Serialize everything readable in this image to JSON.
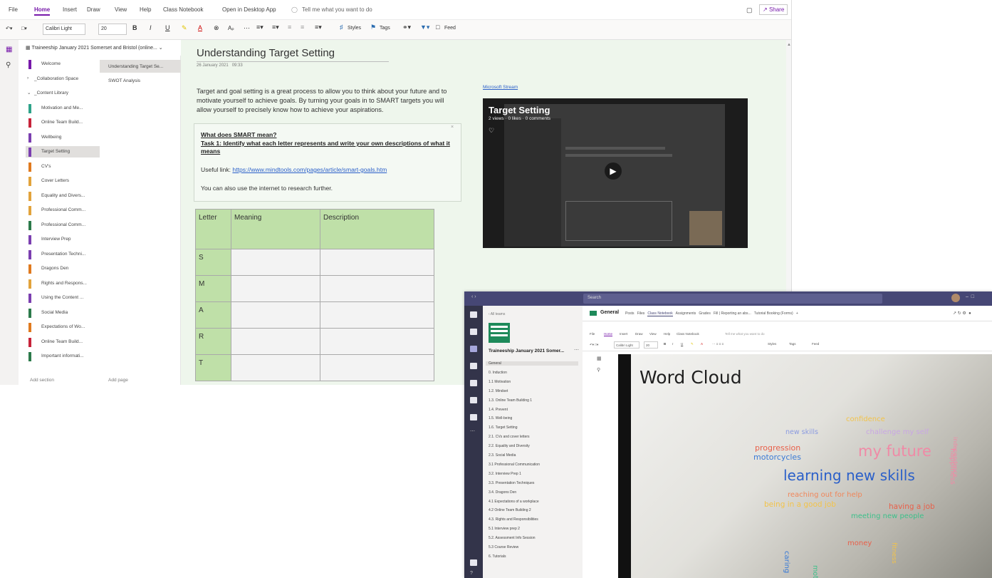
{
  "onenote": {
    "menu": [
      "File",
      "Home",
      "Insert",
      "Draw",
      "View",
      "Help",
      "Class Notebook",
      "Open in Desktop App",
      "Tell me what you want to do"
    ],
    "share_label": "Share",
    "toolbar": {
      "font": "Calibri Light",
      "size": "20",
      "styles": "Styles",
      "tags": "Tags",
      "feed": "Feed"
    },
    "notebook_name": "Traineeship January 2021 Somerset and Bristol (online...",
    "sections": [
      {
        "label": "Welcome",
        "color": "#7719aa"
      },
      {
        "label": "_Collaboration Space",
        "color": ""
      },
      {
        "label": "_Content Library",
        "color": ""
      },
      {
        "label": "Motivation and Me...",
        "color": "#2fa38a"
      },
      {
        "label": "Online Team Build...",
        "color": "#c7233a"
      },
      {
        "label": "Wellbeing",
        "color": "#7b3fb0"
      },
      {
        "label": "Target Setting",
        "color": "#7b3fb0"
      },
      {
        "label": "CV's",
        "color": "#e07a1f"
      },
      {
        "label": "Cover Letters",
        "color": "#e2a33c"
      },
      {
        "label": "Equality and Divers...",
        "color": "#e2a33c"
      },
      {
        "label": "Professional Comm...",
        "color": "#e2a33c"
      },
      {
        "label": "Professional Comm...",
        "color": "#2c7a4b"
      },
      {
        "label": "Interview Prep",
        "color": "#7b3fb0"
      },
      {
        "label": "Presentation Techni...",
        "color": "#7b3fb0"
      },
      {
        "label": "Dragons Den",
        "color": "#e07a1f"
      },
      {
        "label": "Rights and Respons...",
        "color": "#e2a33c"
      },
      {
        "label": "Using the Content ...",
        "color": "#7b3fb0"
      },
      {
        "label": "Social Media",
        "color": "#2c7a4b"
      },
      {
        "label": "Expectations of Wo...",
        "color": "#e07a1f"
      },
      {
        "label": "Online Team Build...",
        "color": "#c7233a"
      },
      {
        "label": "Important informati...",
        "color": "#2c7a4b"
      }
    ],
    "add_section": "Add section",
    "pages": [
      "Understanding Target Se...",
      "SWOT Analysis"
    ],
    "add_page": "Add page",
    "page": {
      "title": "Understanding Target Setting",
      "date": "26 January 2021",
      "time": "09:33",
      "intro": "Target and goal setting  is a great process to allow you to think about your future and to motivate yourself to achieve goals. By turning your goals in to SMART targets you will allow yourself to precisely know how to achieve your aspirations.",
      "box_heading": "What does SMART mean?",
      "box_task": "Task 1:  Identify what each letter represents and write your own descriptions of what it means",
      "useful_prefix": "Useful link: ",
      "useful_link": "https://www.mindtools.com/pages/article/smart-goals.htm",
      "also": "You can also use the internet to research further.",
      "table_headers": [
        "Letter",
        "Meaning",
        "Description"
      ],
      "table_letters": [
        "S",
        "M",
        "A",
        "R",
        "T"
      ],
      "stream_link": "Microsoft Stream",
      "video_title": "Target Setting",
      "video_meta": "2 views · 0 likes · 0 comments"
    }
  },
  "teams": {
    "search": "Search",
    "team_name": "Traineeship January 2021 Somer...",
    "back": "All teams",
    "channels": [
      "General",
      "0. Induction",
      "1.1 Motivation",
      "1.2. Mindset",
      "1.3. Online Team Building 1",
      "1.4. Prevent",
      "1.5. Well-being",
      "1.6. Target Setting",
      "2.1. CVs and cover letters",
      "2.2. Equality and Diversity",
      "2.3. Social Media",
      "3.1 Professional Communication",
      "3.2. Interview Prep 1",
      "3.3. Presentation Techniques",
      "3.4. Dragons Den",
      "4.1 Expectations of a workplace",
      "4.2 Online Team Building 2",
      "4.3. Rights and Responsibilities",
      "5.1 Interview prep 2",
      "5.2. Assessment Info Session",
      "5.3 Course Review",
      "6. Tutorials"
    ],
    "channel_title": "General",
    "channel_tabs": [
      "Posts",
      "Files",
      "Class Notebook",
      "Assignments",
      "Grades",
      "Fill | Reporting an abs...",
      "Tutorial Booking (Forms)"
    ],
    "slide_title": "Word Cloud",
    "words": [
      {
        "text": "new skills",
        "color": "#8a9ae0"
      },
      {
        "text": "confidence",
        "color": "#f2c34a"
      },
      {
        "text": "challenge my self",
        "color": "#c9a7e3"
      },
      {
        "text": "progression",
        "color": "#e8604a"
      },
      {
        "text": "motorcycles",
        "color": "#3b7bd6"
      },
      {
        "text": "my future",
        "color": "#f08aa6"
      },
      {
        "text": "learning new skills",
        "color": "#2a5fc9"
      },
      {
        "text": "reaching out for help",
        "color": "#f0865a"
      },
      {
        "text": "being in a good job",
        "color": "#f2c34a"
      },
      {
        "text": "having a job",
        "color": "#e8604a"
      },
      {
        "text": "meeting new people",
        "color": "#3cc08a"
      },
      {
        "text": "caring",
        "color": "#3b7bd6"
      },
      {
        "text": "motivation",
        "color": "#3cc08a"
      },
      {
        "text": "money",
        "color": "#e8604a"
      },
      {
        "text": "fitness",
        "color": "#f2c34a"
      },
      {
        "text": "happiness",
        "color": "#f08aa6"
      },
      {
        "text": "independence",
        "color": "#f08aa6"
      }
    ]
  }
}
